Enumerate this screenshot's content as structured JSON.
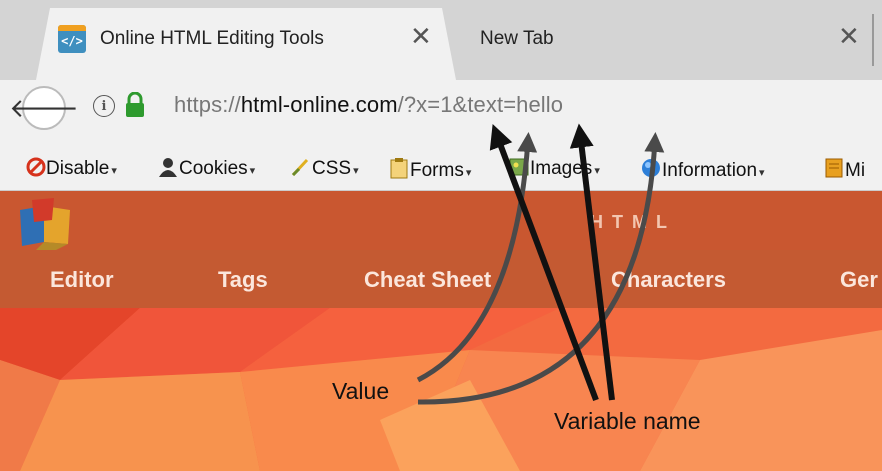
{
  "browser": {
    "tabs": [
      {
        "title": "Online HTML Editing Tools",
        "favicon": "</>"
      },
      {
        "title": "New Tab"
      }
    ],
    "close_glyph": "✕",
    "address": {
      "scheme": "https://",
      "host": "html-online.com",
      "path_query": "/?x=1&text=hello"
    },
    "bookmarks": [
      {
        "label": "Disable",
        "icon": "disable-icon"
      },
      {
        "label": "Cookies",
        "icon": "cookies-icon"
      },
      {
        "label": "CSS",
        "icon": "css-icon"
      },
      {
        "label": "Forms",
        "icon": "forms-icon"
      },
      {
        "label": "Images",
        "icon": "images-icon"
      },
      {
        "label": "Information",
        "icon": "information-icon"
      },
      {
        "label": "Mi",
        "icon": "misc-icon"
      }
    ]
  },
  "site": {
    "title": "HTML",
    "nav": [
      "Editor",
      "Tags",
      "Cheat Sheet",
      "Characters",
      "Ger"
    ]
  },
  "annotations": {
    "value_label": "Value",
    "variable_label": "Variable name"
  },
  "colors": {
    "header": "#c95730",
    "nav": "#c45a32",
    "hero_base": "#f0643a"
  }
}
